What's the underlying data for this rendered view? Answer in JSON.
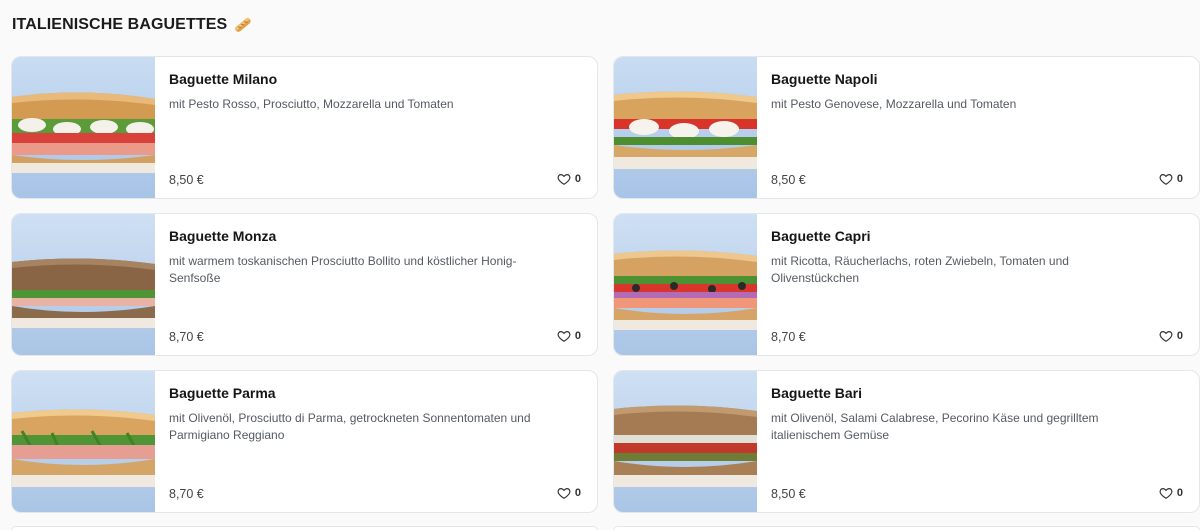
{
  "section": {
    "title": "ITALIENISCHE BAGUETTES",
    "emoji_icon": "baguette-icon"
  },
  "colors": {
    "card_border": "#e4e6ea",
    "background": "#fafafa",
    "image_backdrop": "#b9cfe8"
  },
  "products": [
    {
      "name": "Baguette Milano",
      "description": "mit Pesto Rosso, Prosciutto, Mozzarella und Tomaten",
      "price": "8,50 €",
      "likes": "0",
      "image_icon": "baguette-milano-photo"
    },
    {
      "name": "Baguette Napoli",
      "description": "mit Pesto Genovese, Mozzarella und Tomaten",
      "price": "8,50 €",
      "likes": "0",
      "image_icon": "baguette-napoli-photo"
    },
    {
      "name": "Baguette Monza",
      "description": "mit warmem toskanischen Prosciutto Bollito und köstlicher Honig-Senfsoße",
      "price": "8,70 €",
      "likes": "0",
      "image_icon": "baguette-monza-photo"
    },
    {
      "name": "Baguette Capri",
      "description": "mit Ricotta, Räucherlachs, roten Zwiebeln, Tomaten und Olivenstückchen",
      "price": "8,70 €",
      "likes": "0",
      "image_icon": "baguette-capri-photo"
    },
    {
      "name": "Baguette Parma",
      "description": "mit Olivenöl, Prosciutto di Parma, getrockneten Sonnentomaten und Parmigiano Reggiano",
      "price": "8,70 €",
      "likes": "0",
      "image_icon": "baguette-parma-photo"
    },
    {
      "name": "Baguette Bari",
      "description": "mit Olivenöl, Salami Calabrese, Pecorino Käse und gegrilltem italienischem Gemüse",
      "price": "8,50 €",
      "likes": "0",
      "image_icon": "baguette-bari-photo"
    }
  ]
}
